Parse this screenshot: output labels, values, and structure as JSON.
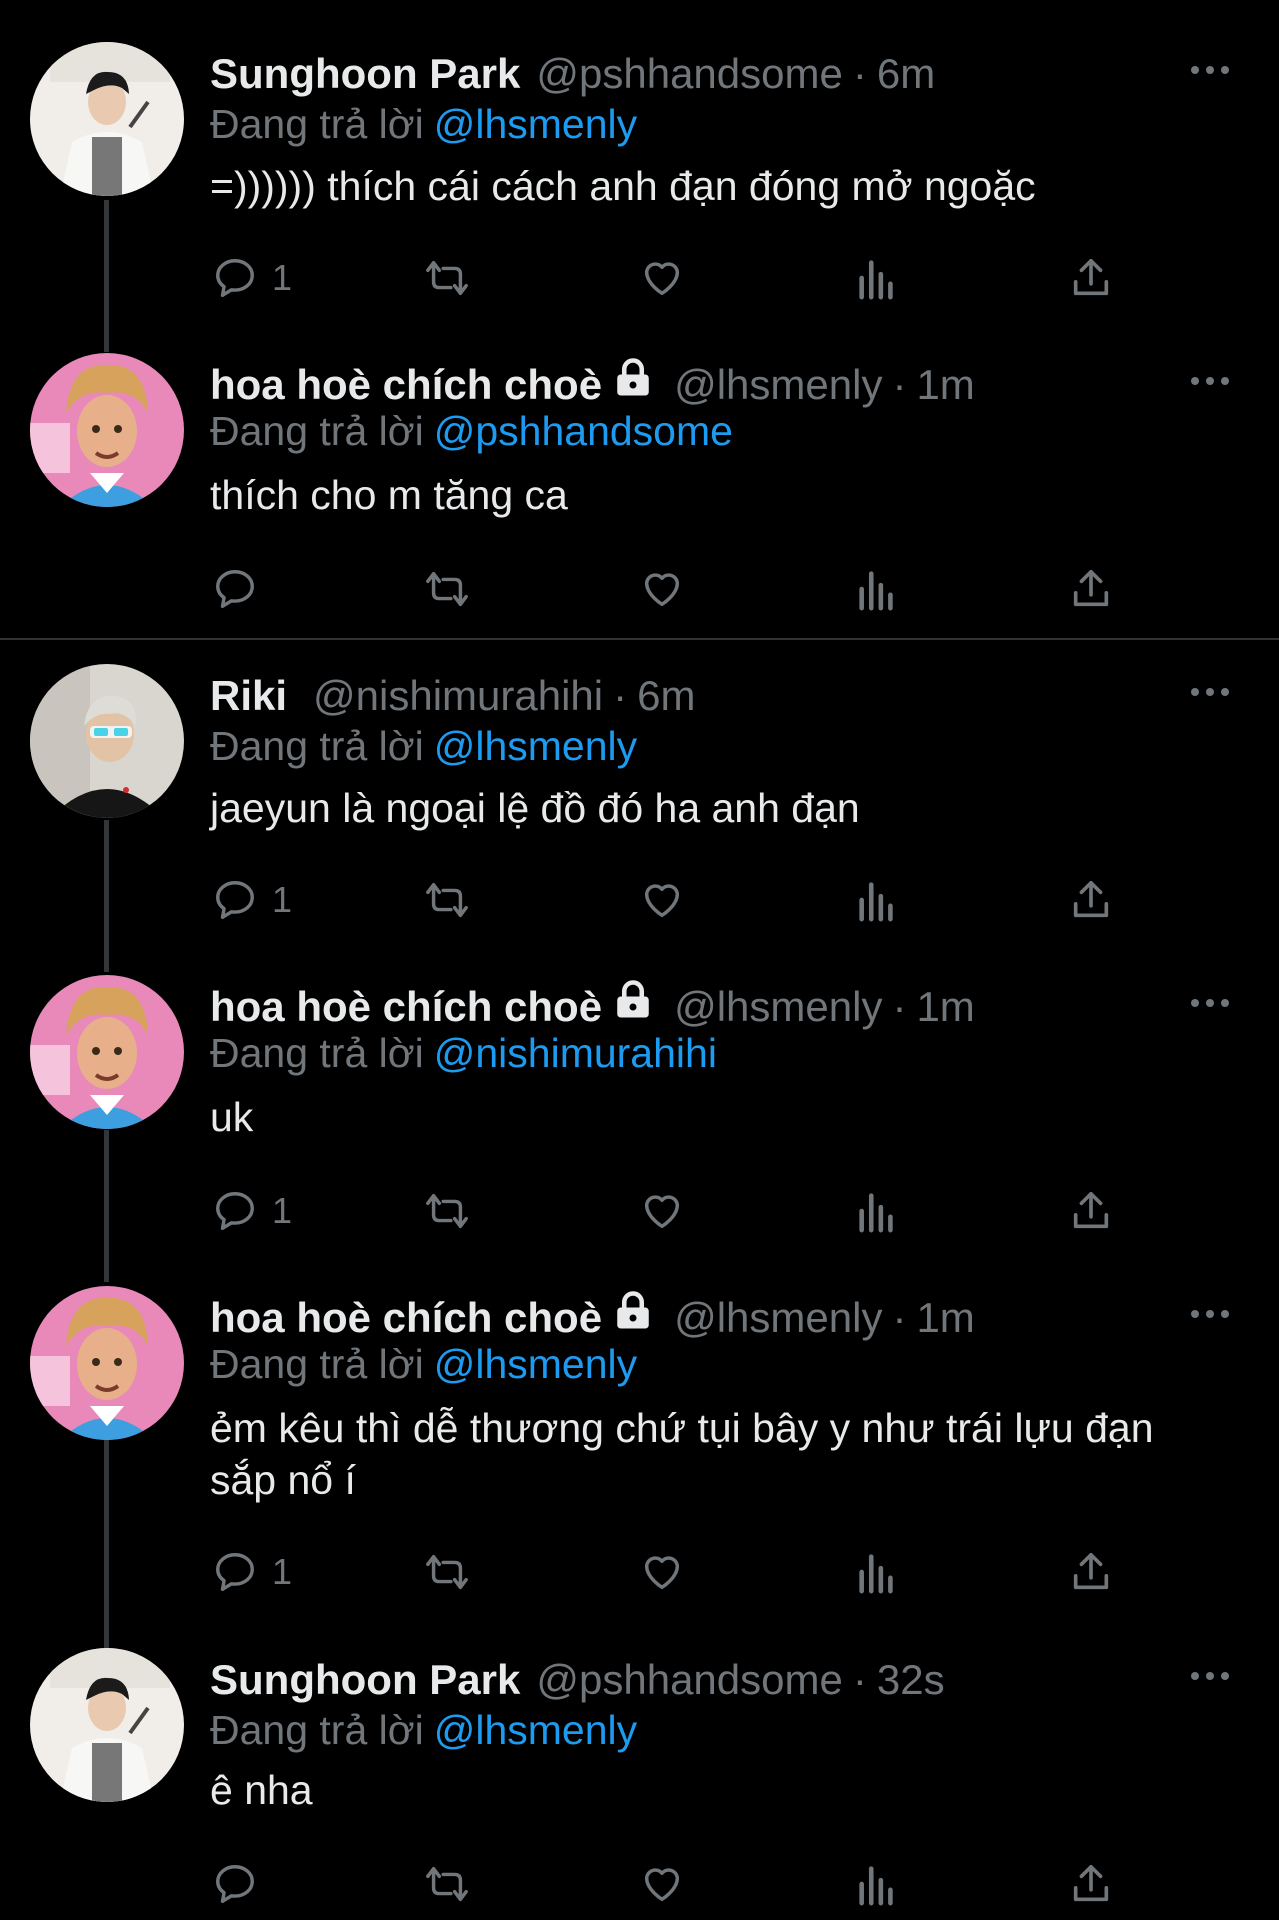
{
  "colors": {
    "background": "#000000",
    "text": "#e7e9ea",
    "muted": "#71767b",
    "mention": "#1d9bf0",
    "thread_line": "#333639"
  },
  "reply_prefix": "Đang trả lời",
  "tweets": [
    {
      "name": "Sunghoon Park",
      "handle": "@pshhandsome",
      "time": "6m",
      "locked": false,
      "reply_to": "@lhsmenly",
      "text": "=)))))) thích cái cách anh đạn đóng mở ngoặc",
      "reply_count": "1",
      "avatar": "sunghoon-avatar"
    },
    {
      "name": "hoa hoè chích choè",
      "handle": "@lhsmenly",
      "time": "1m",
      "locked": true,
      "reply_to": "@pshhandsome",
      "text": "thích cho m tăng ca",
      "reply_count": "",
      "avatar": "ken-avatar"
    },
    {
      "name": "Riki",
      "handle": "@nishimurahihi",
      "time": "6m",
      "locked": false,
      "reply_to": "@lhsmenly",
      "text": "jaeyun là ngoại lệ đồ đó ha anh đạn",
      "reply_count": "1",
      "avatar": "riki-avatar"
    },
    {
      "name": "hoa hoè chích choè",
      "handle": "@lhsmenly",
      "time": "1m",
      "locked": true,
      "reply_to": "@nishimurahihi",
      "text": "uk",
      "reply_count": "1",
      "avatar": "ken-avatar"
    },
    {
      "name": "hoa hoè chích choè",
      "handle": "@lhsmenly",
      "time": "1m",
      "locked": true,
      "reply_to": "@lhsmenly",
      "text": "ẻm kêu thì dễ thương chứ tụi bây y như trái lựu đạn sắp nổ í",
      "reply_count": "1",
      "avatar": "ken-avatar"
    },
    {
      "name": "Sunghoon Park",
      "handle": "@pshhandsome",
      "time": "32s",
      "locked": false,
      "reply_to": "@lhsmenly",
      "text": "ê nha",
      "reply_count": "",
      "avatar": "sunghoon-avatar"
    }
  ]
}
